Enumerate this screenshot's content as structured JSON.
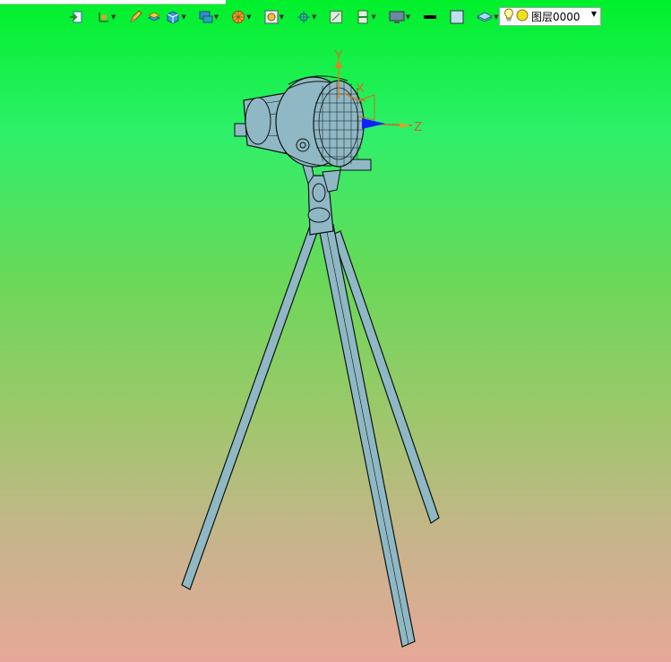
{
  "toolbar": {
    "buttons": [
      {
        "name": "import-icon",
        "dropdown": false
      },
      {
        "name": "coordinate-system-icon",
        "dropdown": true
      },
      {
        "name": "pencil-icon",
        "dropdown": false
      },
      {
        "name": "layer-stack-icon",
        "dropdown": false
      },
      {
        "name": "cube-view-icon",
        "dropdown": true
      },
      {
        "name": "render-mode-icon",
        "dropdown": true
      },
      {
        "name": "wheel-icon",
        "dropdown": true
      },
      {
        "name": "zoom-fit-icon",
        "dropdown": true
      },
      {
        "name": "snap-point-icon",
        "dropdown": true
      },
      {
        "name": "grid-icon",
        "dropdown": false
      },
      {
        "name": "section-icon",
        "dropdown": true
      },
      {
        "name": "display-icon",
        "dropdown": true
      },
      {
        "name": "line-color-icon",
        "dropdown": false
      },
      {
        "name": "fill-color-icon",
        "dropdown": false
      },
      {
        "name": "layer-manager-icon",
        "dropdown": true
      }
    ]
  },
  "layer": {
    "current": "图层0000"
  },
  "axes": {
    "x_label": "X",
    "y_label": "Y",
    "z_label": "Z"
  },
  "colors": {
    "model_fill": "#8fb8c4",
    "model_stroke": "#0a1414",
    "axis_x": "#d07020",
    "axis_y": "#e08020",
    "axis_z": "#d06030",
    "axis_z_arrow": "#1020ff"
  }
}
